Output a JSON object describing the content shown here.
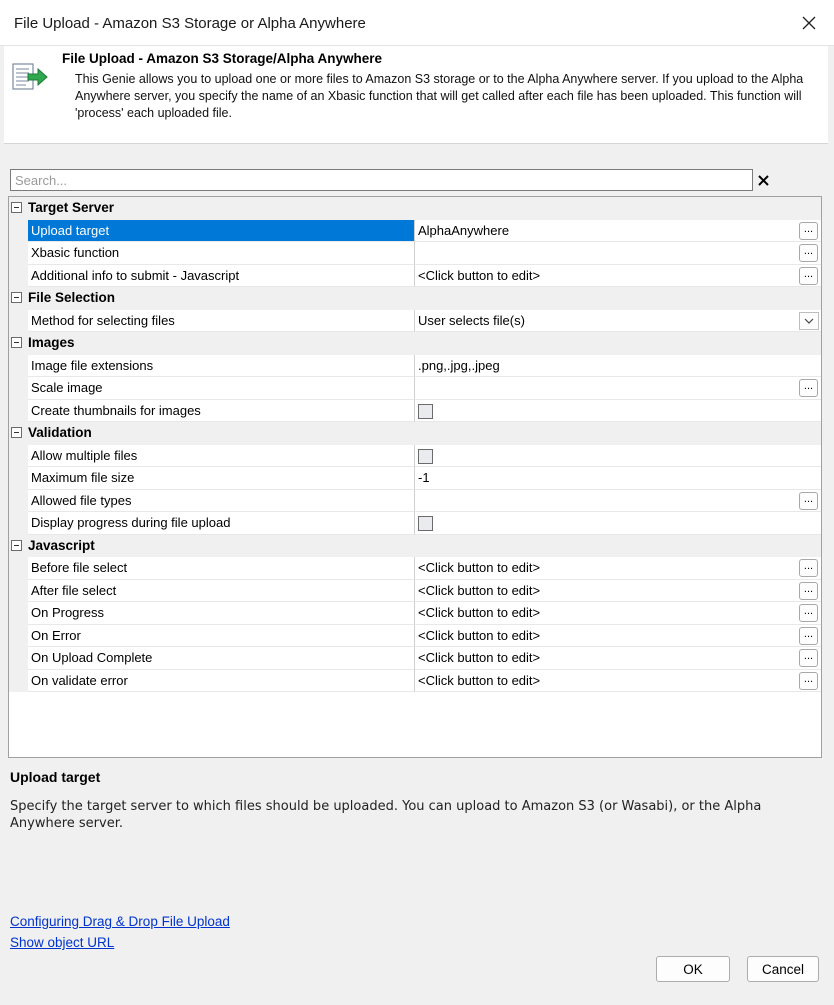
{
  "window": {
    "title": "File Upload - Amazon S3 Storage or Alpha Anywhere"
  },
  "header": {
    "title": "File Upload - Amazon S3 Storage/Alpha Anywhere",
    "description": "This Genie allows you to upload one or more files to Amazon S3 storage or to the Alpha Anywhere server. If you upload to the Alpha Anywhere server, you specify the name of an Xbasic function that will get called after each file has been uploaded. This function will 'process' each uploaded file."
  },
  "search": {
    "placeholder": "Search...",
    "value": ""
  },
  "categories": [
    {
      "label": "Target Server",
      "props": [
        {
          "name": "Upload target",
          "value": "AlphaAnywhere",
          "control": "ellipsis",
          "selected": true
        },
        {
          "name": "Xbasic function",
          "value": "",
          "control": "ellipsis"
        },
        {
          "name": "Additional info to submit - Javascript",
          "value": "<Click button to edit>",
          "control": "ellipsis"
        }
      ]
    },
    {
      "label": "File Selection",
      "props": [
        {
          "name": "Method for selecting files",
          "value": "User selects file(s)",
          "control": "dropdown"
        }
      ]
    },
    {
      "label": "Images",
      "props": [
        {
          "name": "Image file extensions",
          "value": ".png,.jpg,.jpeg",
          "control": "none"
        },
        {
          "name": "Scale image",
          "value": "",
          "control": "ellipsis"
        },
        {
          "name": "Create thumbnails for images",
          "value": "",
          "control": "checkbox",
          "checked": false
        }
      ]
    },
    {
      "label": "Validation",
      "props": [
        {
          "name": "Allow multiple files",
          "value": "",
          "control": "checkbox",
          "checked": false
        },
        {
          "name": "Maximum file size",
          "value": "-1",
          "control": "none"
        },
        {
          "name": "Allowed file types",
          "value": "",
          "control": "ellipsis"
        },
        {
          "name": "Display progress during file upload",
          "value": "",
          "control": "checkbox",
          "checked": false
        }
      ]
    },
    {
      "label": "Javascript",
      "props": [
        {
          "name": "Before file select",
          "value": "<Click button to edit>",
          "control": "ellipsis"
        },
        {
          "name": "After file select",
          "value": "<Click button to edit>",
          "control": "ellipsis"
        },
        {
          "name": "On Progress",
          "value": "<Click button to edit>",
          "control": "ellipsis"
        },
        {
          "name": "On Error",
          "value": "<Click button to edit>",
          "control": "ellipsis"
        },
        {
          "name": "On Upload Complete",
          "value": "<Click button to edit>",
          "control": "ellipsis"
        },
        {
          "name": "On validate error",
          "value": "<Click button to edit>",
          "control": "ellipsis"
        }
      ]
    }
  ],
  "ellipsis_label": "...",
  "help": {
    "title": "Upload target",
    "description": "Specify the target server to which files should be uploaded. You can upload to Amazon S3 (or Wasabi), or the Alpha Anywhere server."
  },
  "links": {
    "drag_drop": "Configuring Drag & Drop File Upload",
    "object_url": "Show object URL"
  },
  "buttons": {
    "ok": "OK",
    "cancel": "Cancel"
  },
  "colors": {
    "selection": "#0078d7",
    "link": "#0033cc",
    "icon_arrow": "#2fa84f"
  },
  "icons": {
    "close": "close-icon",
    "genie": "file-upload-genie-icon",
    "search_clear": "clear-search-icon",
    "category": "collapse-icon",
    "dropdown": "chevron-down-icon"
  }
}
